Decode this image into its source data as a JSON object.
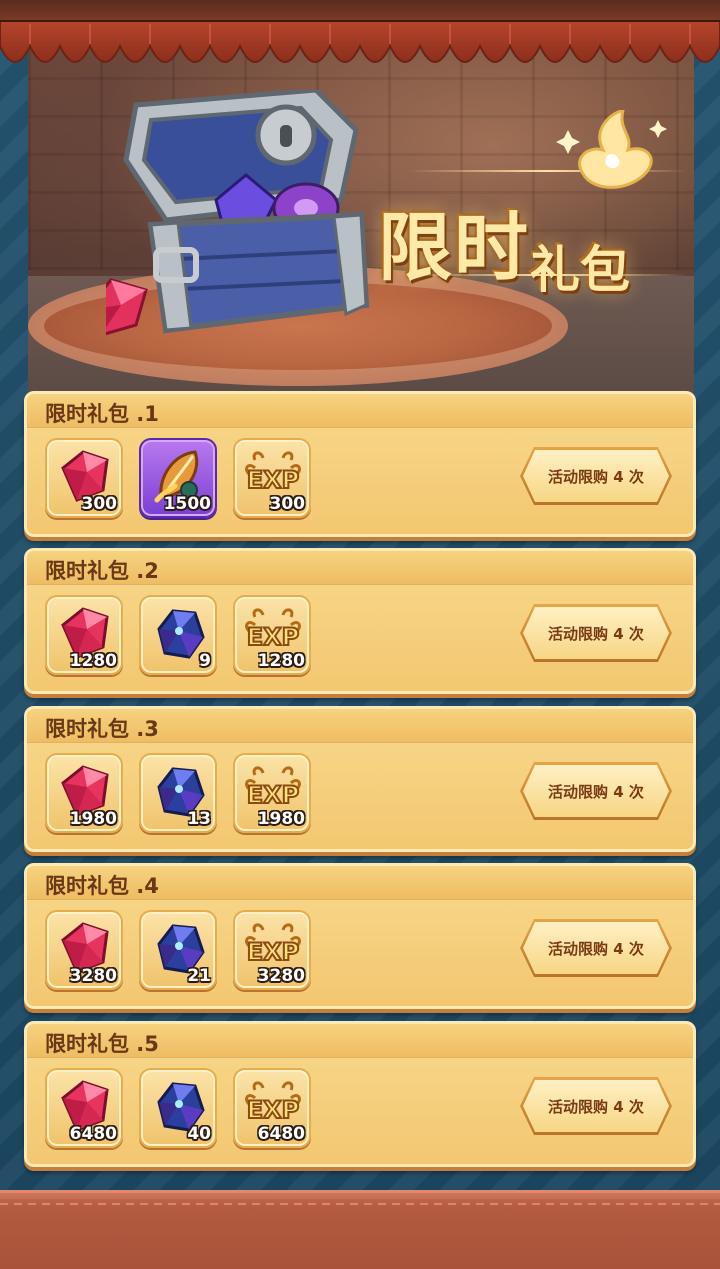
{
  "banner": {
    "title_big": "限时",
    "title_small": "礼包"
  },
  "colors": {
    "pack_bg": "#f8d98d",
    "pack_border": "#fde9b4",
    "title_text": "#6a3814",
    "button_text": "#7a3a12",
    "background": "#1e4a66",
    "bottom_bar": "#b45a40"
  },
  "packs": [
    {
      "title": "限时礼包 .1",
      "items": [
        {
          "icon": "ruby-gem-icon",
          "qty": "300"
        },
        {
          "icon": "golden-feather-icon",
          "qty": "1500"
        },
        {
          "icon": "exp-badge-icon",
          "qty": "300"
        }
      ],
      "button": "活动限购 4 次"
    },
    {
      "title": "限时礼包 .2",
      "items": [
        {
          "icon": "ruby-gem-icon",
          "qty": "1280"
        },
        {
          "icon": "blue-crystal-icon",
          "qty": "9"
        },
        {
          "icon": "exp-badge-icon",
          "qty": "1280"
        }
      ],
      "button": "活动限购 4 次"
    },
    {
      "title": "限时礼包 .3",
      "items": [
        {
          "icon": "ruby-gem-icon",
          "qty": "1980"
        },
        {
          "icon": "blue-crystal-icon",
          "qty": "13"
        },
        {
          "icon": "exp-badge-icon",
          "qty": "1980"
        }
      ],
      "button": "活动限购 4 次"
    },
    {
      "title": "限时礼包 .4",
      "items": [
        {
          "icon": "ruby-gem-icon",
          "qty": "3280"
        },
        {
          "icon": "blue-crystal-icon",
          "qty": "21"
        },
        {
          "icon": "exp-badge-icon",
          "qty": "3280"
        }
      ],
      "button": "活动限购 4 次"
    },
    {
      "title": "限时礼包 .5",
      "items": [
        {
          "icon": "ruby-gem-icon",
          "qty": "6480"
        },
        {
          "icon": "blue-crystal-icon",
          "qty": "40"
        },
        {
          "icon": "exp-badge-icon",
          "qty": "6480"
        }
      ],
      "button": "活动限购 4 次"
    }
  ]
}
